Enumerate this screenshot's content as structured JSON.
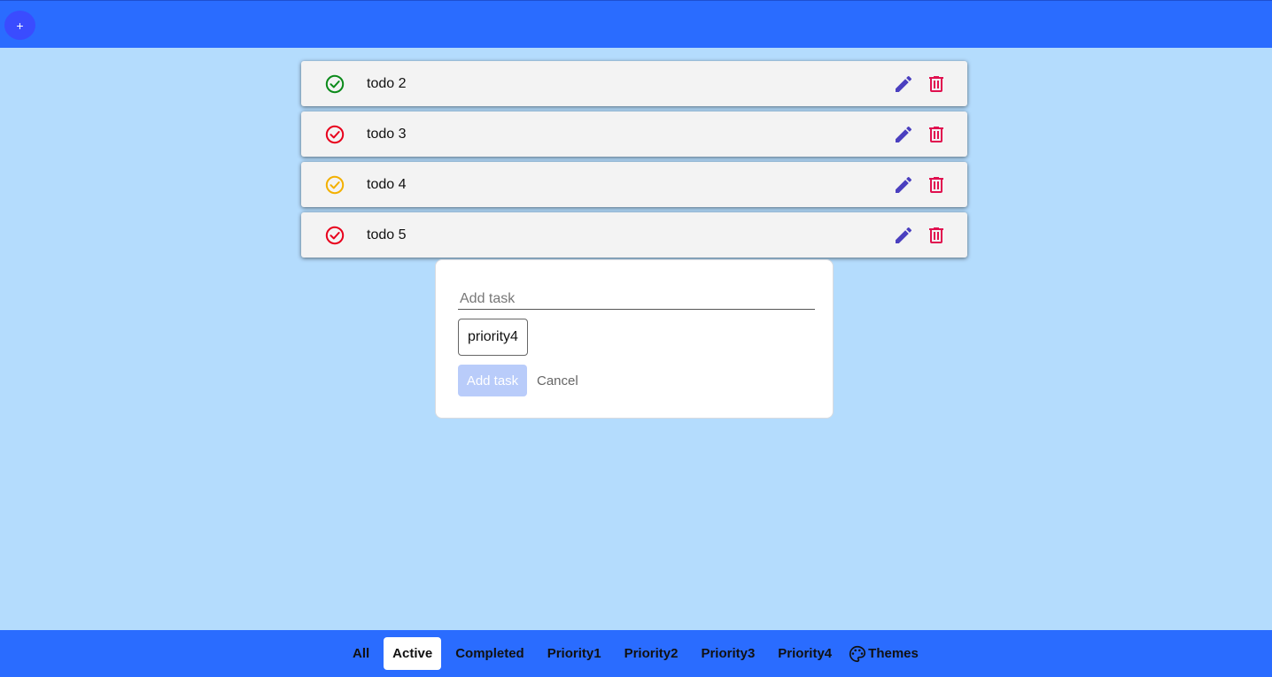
{
  "header": {
    "add_button_label": "+"
  },
  "todos": [
    {
      "text": "todo 2",
      "status_color": "#0b8a1a",
      "check_icon": "check-circle-icon"
    },
    {
      "text": "todo 3",
      "status_color": "#e8001c",
      "check_icon": "check-circle-icon"
    },
    {
      "text": "todo 4",
      "status_color": "#f3b000",
      "check_icon": "check-circle-icon"
    },
    {
      "text": "todo 5",
      "status_color": "#e8001c",
      "check_icon": "check-circle-icon"
    }
  ],
  "item_actions": {
    "edit_icon": "pencil-icon",
    "delete_icon": "trash-icon",
    "edit_color": "#4a3fbf",
    "delete_color": "#e0104f"
  },
  "add_form": {
    "placeholder": "Add task",
    "value": "",
    "priority_selected": "priority4",
    "submit_label": "Add task",
    "cancel_label": "Cancel"
  },
  "footer": {
    "filters": [
      "All",
      "Active",
      "Completed",
      "Priority1",
      "Priority2",
      "Priority3",
      "Priority4"
    ],
    "active_filter": "Active",
    "themes_label": "Themes",
    "themes_icon": "palette-icon"
  },
  "colors": {
    "background": "#b4dcfd",
    "bars": "#2a6cff"
  }
}
